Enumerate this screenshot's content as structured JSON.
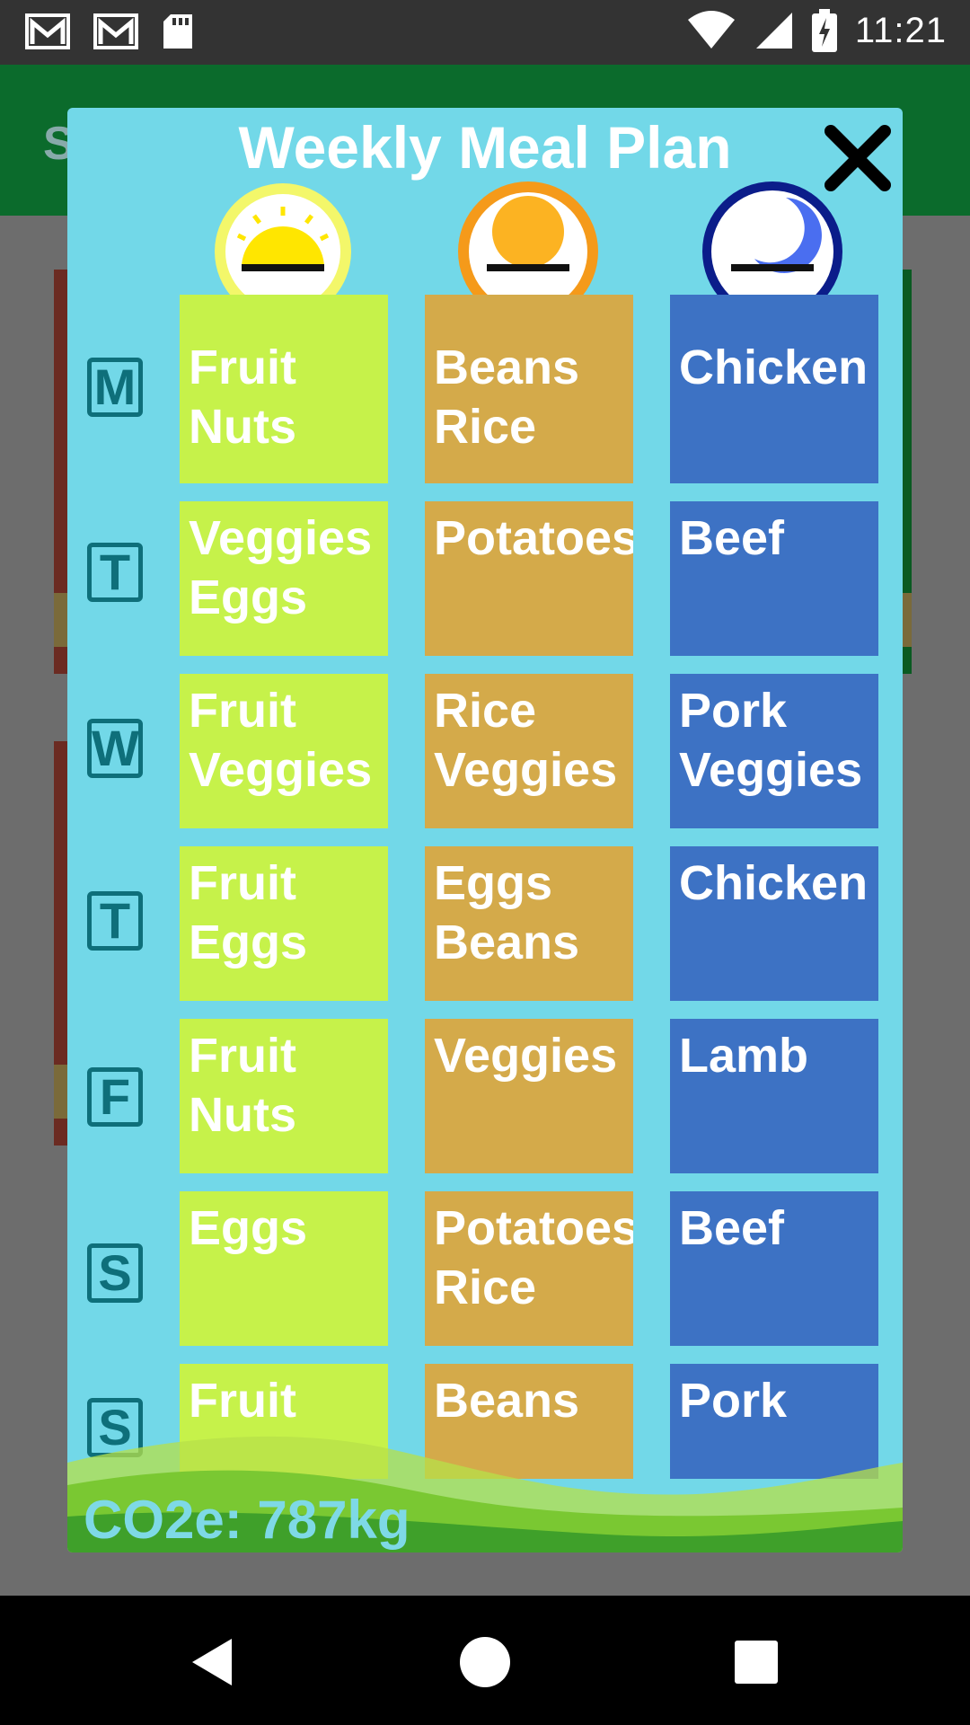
{
  "status_bar": {
    "time": "11:21",
    "icons": [
      "gmail-icon",
      "gmail-icon",
      "sd-card-icon",
      "wifi-icon",
      "cell-signal-icon",
      "battery-charging-icon"
    ]
  },
  "background_app": {
    "title_fragment": "S"
  },
  "dialog": {
    "title": "Weekly Meal Plan",
    "close_icon": "close-icon",
    "meal_icons": [
      "sun-breakfast-icon",
      "sun-lunch-icon",
      "moon-dinner-icon"
    ],
    "days": [
      "M",
      "T",
      "W",
      "T",
      "F",
      "S",
      "S"
    ],
    "meals": [
      {
        "breakfast": "Fruit\nNuts",
        "lunch": "Beans\nRice",
        "dinner": "Chicken"
      },
      {
        "breakfast": "Veggies\nEggs",
        "lunch": "Potatoes",
        "dinner": "Beef"
      },
      {
        "breakfast": "Fruit\nVeggies",
        "lunch": "Rice\nVeggies",
        "dinner": "Pork\nVeggies"
      },
      {
        "breakfast": "Fruit\nEggs",
        "lunch": "Eggs\nBeans",
        "dinner": "Chicken"
      },
      {
        "breakfast": "Fruit\nNuts",
        "lunch": "Veggies",
        "dinner": "Lamb"
      },
      {
        "breakfast": "Eggs",
        "lunch": "Potatoes\nRice",
        "dinner": "Beef"
      },
      {
        "breakfast": "Fruit",
        "lunch": "Beans",
        "dinner": "Pork"
      }
    ],
    "footer": "CO2e: 787kg",
    "colors": {
      "dialog_bg": "#72d8e8",
      "breakfast": "#c6f24a",
      "lunch": "#d4aa4a",
      "dinner": "#3d72c4"
    }
  },
  "nav_bar": {
    "back": "back-icon",
    "home": "home-icon",
    "recents": "recents-icon"
  }
}
